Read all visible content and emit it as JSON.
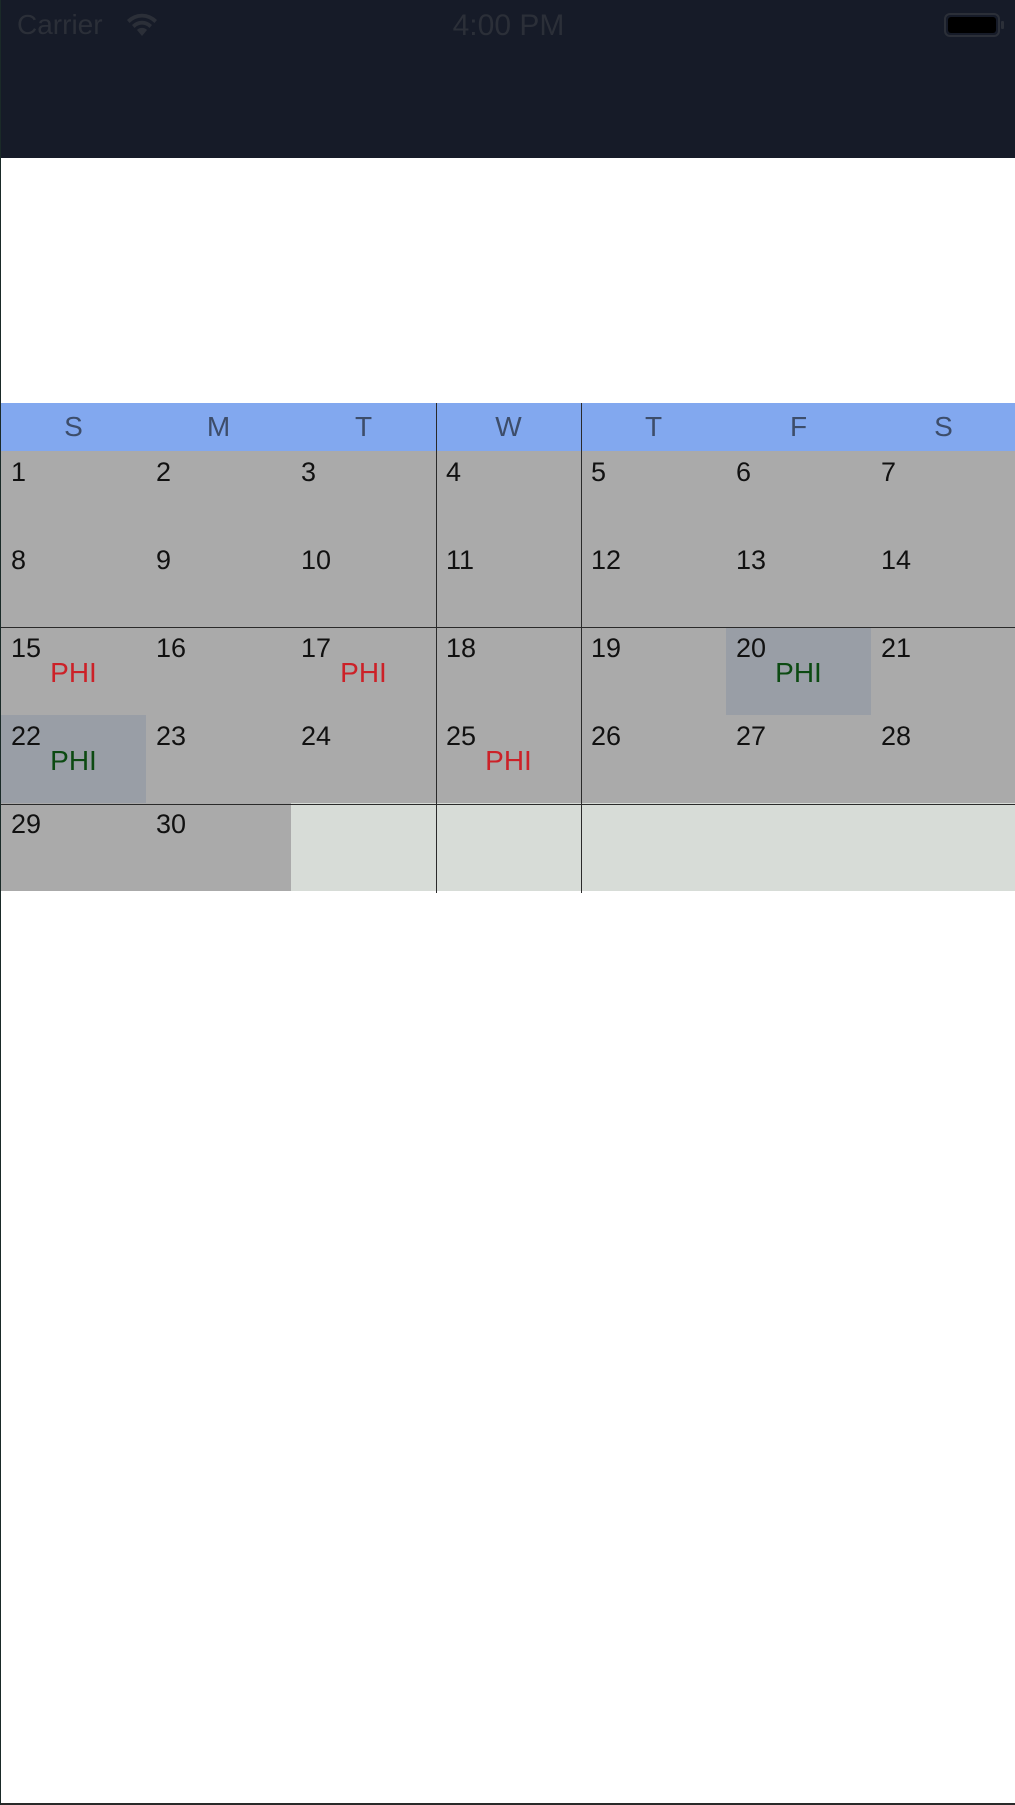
{
  "status_bar": {
    "carrier": "Carrier",
    "time": "4:00 PM",
    "icons": [
      "wifi-icon",
      "battery-icon"
    ]
  },
  "colors": {
    "navbar": "#161b28",
    "weekday_header": "#82a8ef",
    "day_cell": "#aaaaaa",
    "highlight_cell": "#999ea6",
    "empty_cell": "#d7dcd7",
    "event_red": "#cc2128",
    "event_green": "#0c4a12"
  },
  "calendar": {
    "weekdays": [
      "S",
      "M",
      "T",
      "W",
      "T",
      "F",
      "S"
    ],
    "days": [
      {
        "num": "1"
      },
      {
        "num": "2"
      },
      {
        "num": "3"
      },
      {
        "num": "4"
      },
      {
        "num": "5"
      },
      {
        "num": "6"
      },
      {
        "num": "7"
      },
      {
        "num": "8"
      },
      {
        "num": "9"
      },
      {
        "num": "10"
      },
      {
        "num": "11"
      },
      {
        "num": "12"
      },
      {
        "num": "13"
      },
      {
        "num": "14"
      },
      {
        "num": "15",
        "event": "PHI",
        "event_color": "red"
      },
      {
        "num": "16"
      },
      {
        "num": "17",
        "event": "PHI",
        "event_color": "red"
      },
      {
        "num": "18"
      },
      {
        "num": "19"
      },
      {
        "num": "20",
        "event": "PHI",
        "event_color": "green",
        "highlight": true
      },
      {
        "num": "21"
      },
      {
        "num": "22",
        "event": "PHI",
        "event_color": "green",
        "highlight": true
      },
      {
        "num": "23"
      },
      {
        "num": "24"
      },
      {
        "num": "25",
        "event": "PHI",
        "event_color": "red"
      },
      {
        "num": "26"
      },
      {
        "num": "27"
      },
      {
        "num": "28"
      },
      {
        "num": "29"
      },
      {
        "num": "30"
      }
    ],
    "trailing_empty": 5
  }
}
